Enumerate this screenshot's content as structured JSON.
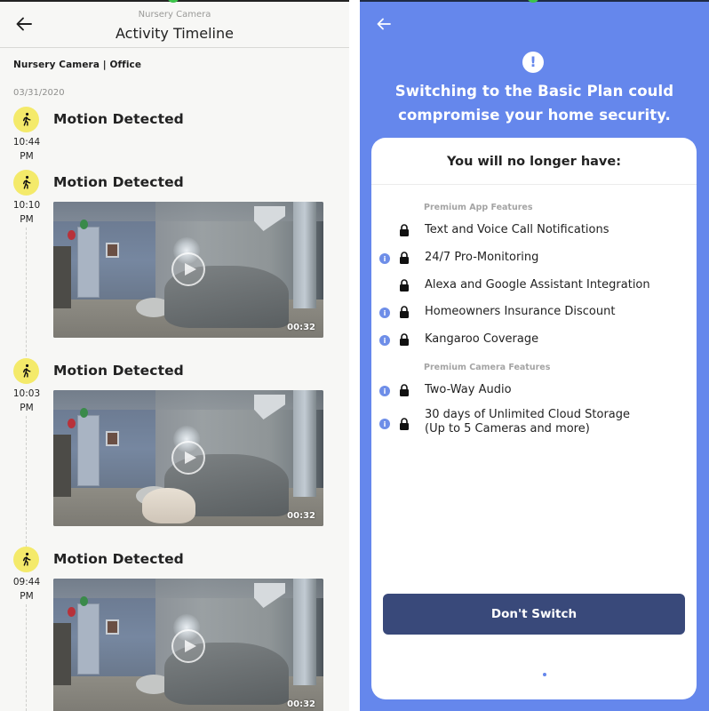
{
  "left": {
    "header": {
      "subtitle": "Nursery Camera",
      "title": "Activity Timeline"
    },
    "location": "Nursery Camera | Office",
    "date": "03/31/2020",
    "events": [
      {
        "title": "Motion Detected",
        "time": "10:44",
        "ampm": "PM",
        "has_clip": false
      },
      {
        "title": "Motion Detected",
        "time": "10:10",
        "ampm": "PM",
        "has_clip": true,
        "duration": "00:32"
      },
      {
        "title": "Motion Detected",
        "time": "10:03",
        "ampm": "PM",
        "has_clip": true,
        "duration": "00:32"
      },
      {
        "title": "Motion Detected",
        "time": "09:44",
        "ampm": "PM",
        "has_clip": true,
        "duration": "00:32"
      }
    ],
    "icons": {
      "back": "arrow-left-icon",
      "event": "walking-person-icon",
      "play": "play-icon"
    },
    "colors": {
      "badge": "#f4ea6a",
      "background": "#f7f7f5"
    }
  },
  "right": {
    "headline_line1": "Switching to the Basic Plan could",
    "headline_line2": "compromise your home security.",
    "card": {
      "title": "You will no longer have:",
      "sections": [
        {
          "label": "Premium App Features",
          "features": [
            {
              "label": "Text and Voice Call Notifications",
              "info": false
            },
            {
              "label": "24/7 Pro-Monitoring",
              "info": true
            },
            {
              "label": "Alexa and Google Assistant Integration",
              "info": false
            },
            {
              "label": "Homeowners Insurance Discount",
              "info": true
            },
            {
              "label": "Kangaroo Coverage",
              "info": true
            }
          ]
        },
        {
          "label": "Premium Camera Features",
          "features": [
            {
              "label": "Two-Way Audio",
              "info": true
            },
            {
              "label_line1": "30 days of Unlimited Cloud Storage",
              "label_line2": "(Up to 5 Cameras and more)",
              "info": true
            }
          ]
        }
      ],
      "button": "Don't Switch"
    },
    "icons": {
      "back": "arrow-left-icon",
      "alert": "exclamation-circle-icon",
      "info": "info-icon",
      "lock": "lock-icon"
    },
    "colors": {
      "background": "#6587ec",
      "button": "#39497a",
      "info": "#6e8ee8"
    }
  }
}
